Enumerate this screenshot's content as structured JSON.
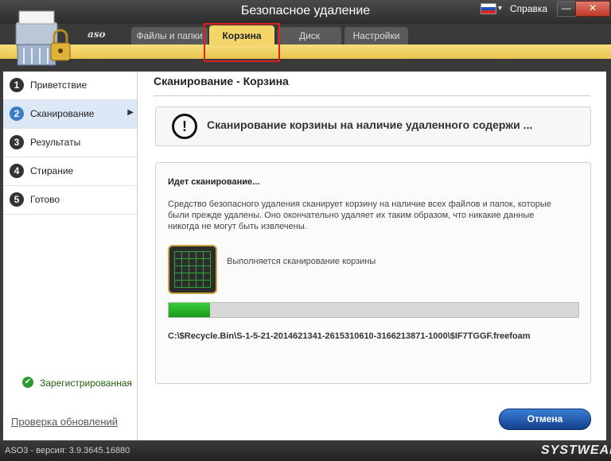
{
  "window": {
    "title": "Безопасное удаление",
    "help_label": "Справка",
    "minimize_label": "—",
    "close_label": "✕",
    "language_flag_icon": "russia-flag-icon"
  },
  "logo": {
    "text": "aso"
  },
  "tabs": [
    {
      "label": "Файлы и папки",
      "active": false
    },
    {
      "label": "Корзина",
      "active": true
    },
    {
      "label": "Диск",
      "active": false
    },
    {
      "label": "Настройки",
      "active": false
    }
  ],
  "sidebar": {
    "steps": [
      {
        "num": "1",
        "label": "Приветствие",
        "active": false
      },
      {
        "num": "2",
        "label": "Сканирование",
        "active": true
      },
      {
        "num": "3",
        "label": "Результаты",
        "active": false
      },
      {
        "num": "4",
        "label": "Стирание",
        "active": false
      },
      {
        "num": "5",
        "label": "Готово",
        "active": false
      }
    ],
    "registered_label": "Зарегистрированная",
    "check_updates_label": "Проверка обновлений"
  },
  "main": {
    "title": "Сканирование - Корзина",
    "notice_text": "Сканирование корзины на наличие удаленного содержи ...",
    "scan_heading": "Идет сканирование...",
    "scan_description": "Средство безопасного удаления сканирует корзину на наличие всех файлов и папок, которые были прежде удалены. Оно окончательно удаляет их таким образом, что никакие данные никогда не могут быть извлечены.",
    "scan_status": "Выполняется сканирование корзины",
    "progress_fraction": 0.1,
    "current_path": "C:\\$Recycle.Bin\\S-1-5-21-2014621341-2615310610-3166213871-1000\\$IF7TGGF.freefoam",
    "cancel_label": "Отмена"
  },
  "status": {
    "version": "ASO3 - версия: 3.9.3645.16880",
    "brand": "SYSTWEAK"
  },
  "colors": {
    "accent_yellow": "#f3d56a",
    "progress_green": "#1a9b1a",
    "highlight_red": "#e02020",
    "button_blue": "#1f5bb8"
  }
}
